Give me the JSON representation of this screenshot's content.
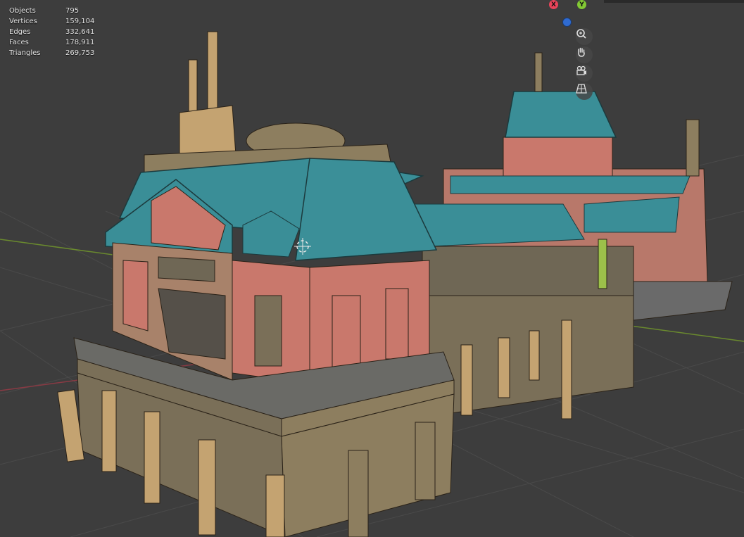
{
  "stats": {
    "rows": [
      {
        "label": "Objects",
        "value": "795"
      },
      {
        "label": "Vertices",
        "value": "159,104"
      },
      {
        "label": "Edges",
        "value": "332,641"
      },
      {
        "label": "Faces",
        "value": "178,911"
      },
      {
        "label": "Triangles",
        "value": "269,753"
      }
    ]
  },
  "gizmo": {
    "x_label": "X",
    "y_label": "Y",
    "x_color": "#e8445a",
    "y_color": "#82c934",
    "z_color": "#2f6bd1"
  },
  "nav_icons": [
    "zoom-icon",
    "pan-hand-icon",
    "camera-icon",
    "grid-perspective-icon"
  ],
  "colors": {
    "background": "#3d3d3d",
    "roof": "#3a8e97",
    "wall": "#c9786c",
    "stone": "#8d7e5f",
    "pillar": "#c4a371"
  }
}
